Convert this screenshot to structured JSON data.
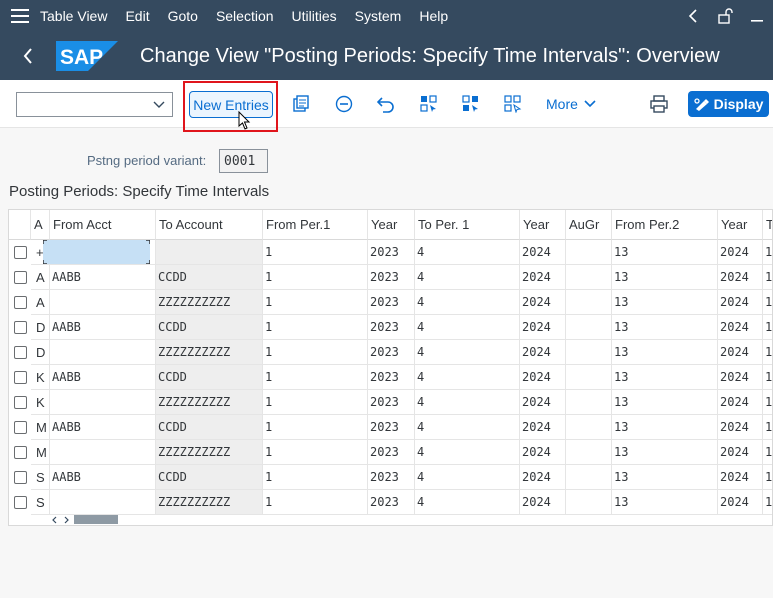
{
  "menubar": {
    "items": [
      "Table View",
      "Edit",
      "Goto",
      "Selection",
      "Utilities",
      "System",
      "Help"
    ]
  },
  "titlebar": {
    "logo_text": "SAP",
    "title": "Change View \"Posting Periods: Specify Time Intervals\": Overview"
  },
  "toolbar": {
    "combo_value": "",
    "new_entries_label": "New Entries",
    "more_label": "More",
    "display_label": "Display",
    "icons": [
      "copy-icon",
      "delete-icon",
      "undo-icon",
      "select-all-icon",
      "select-block-icon",
      "deselect-all-icon",
      "print-icon"
    ]
  },
  "header": {
    "variant_label": "Pstng period variant:",
    "variant_value": "0001"
  },
  "section_title": "Posting Periods: Specify Time Intervals",
  "table": {
    "columns": [
      "A",
      "From Acct",
      "To Account",
      "From Per.1",
      "Year",
      "To Per. 1",
      "Year",
      "AuGr",
      "From Per.2",
      "Year",
      "T"
    ],
    "rows": [
      [
        "+",
        "",
        "",
        "1",
        "2023",
        "4",
        "2024",
        "",
        "13",
        "2024",
        "1"
      ],
      [
        "A",
        "AABB",
        "CCDD",
        "1",
        "2023",
        "4",
        "2024",
        "",
        "13",
        "2024",
        "1"
      ],
      [
        "A",
        "",
        "ZZZZZZZZZZ",
        "1",
        "2023",
        "4",
        "2024",
        "",
        "13",
        "2024",
        "1"
      ],
      [
        "D",
        "AABB",
        "CCDD",
        "1",
        "2023",
        "4",
        "2024",
        "",
        "13",
        "2024",
        "1"
      ],
      [
        "D",
        "",
        "ZZZZZZZZZZ",
        "1",
        "2023",
        "4",
        "2024",
        "",
        "13",
        "2024",
        "1"
      ],
      [
        "K",
        "AABB",
        "CCDD",
        "1",
        "2023",
        "4",
        "2024",
        "",
        "13",
        "2024",
        "1"
      ],
      [
        "K",
        "",
        "ZZZZZZZZZZ",
        "1",
        "2023",
        "4",
        "2024",
        "",
        "13",
        "2024",
        "1"
      ],
      [
        "M",
        "AABB",
        "CCDD",
        "1",
        "2023",
        "4",
        "2024",
        "",
        "13",
        "2024",
        "1"
      ],
      [
        "M",
        "",
        "ZZZZZZZZZZ",
        "1",
        "2023",
        "4",
        "2024",
        "",
        "13",
        "2024",
        "1"
      ],
      [
        "S",
        "AABB",
        "CCDD",
        "1",
        "2023",
        "4",
        "2024",
        "",
        "13",
        "2024",
        "1"
      ],
      [
        "S",
        "",
        "ZZZZZZZZZZ",
        "1",
        "2023",
        "4",
        "2024",
        "",
        "13",
        "2024",
        "1"
      ]
    ]
  },
  "colors": {
    "shell": "#354a5f",
    "accent": "#0a6ed1",
    "highlight_box": "#e0151c",
    "active_cell": "#c6e0f5",
    "key_column": "#eeeeee"
  }
}
